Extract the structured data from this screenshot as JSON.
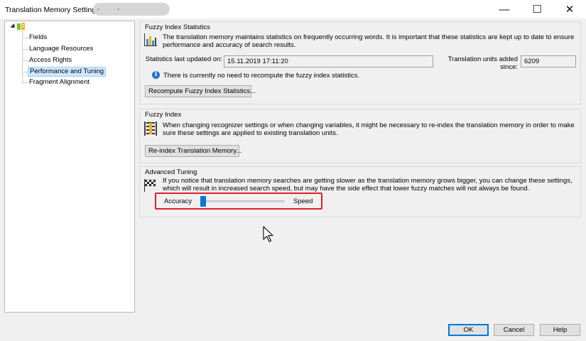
{
  "window": {
    "title": "Translation Memory Settings -",
    "minimize_glyph": "—",
    "maximize_glyph": "☐",
    "close_glyph": "✕"
  },
  "tree": {
    "root_icon": "translation-memory-icon",
    "items": [
      {
        "label": "Fields",
        "selected": false
      },
      {
        "label": "Language Resources",
        "selected": false
      },
      {
        "label": "Access Rights",
        "selected": false
      },
      {
        "label": "Performance and Tuning",
        "selected": true
      },
      {
        "label": "Fragment Alignment",
        "selected": false
      }
    ]
  },
  "fuzzy_stats": {
    "title": "Fuzzy Index Statistics",
    "icon": "bar-chart-icon",
    "description": "The translation memory maintains statistics on frequently occurring words. It is important that these statistics are kept up to date to ensure performance and accuracy of search results.",
    "last_updated_label": "Statistics last updated on:",
    "last_updated_value": "15.11.2019 17:11:20",
    "units_label": "Translation units added since:",
    "units_value": "6209",
    "info_text": "There is currently no need to recompute the fuzzy index statistics.",
    "recompute_button": "Recompute Fuzzy Index Statistics..."
  },
  "fuzzy_index": {
    "title": "Fuzzy Index",
    "icon": "index-ruler-icon",
    "description": "When changing recognizer settings or when changing variables, it might be necessary to re-index the translation memory in order to make sure these settings are applied to existing translation units.",
    "reindex_button": "Re-index Translation Memory..."
  },
  "advanced_tuning": {
    "title": "Advanced Tuning",
    "icon": "checkered-flag-icon",
    "description": "If you notice that translation memory searches are getting slower as the translation memory grows bigger, you can change these settings, which will result in increased search speed, but may have the side effect that lower fuzzy matches will not always be found.",
    "slider_left_label": "Accuracy",
    "slider_right_label": "Speed",
    "slider_value_fraction": 0.02
  },
  "footer": {
    "ok": "OK",
    "cancel": "Cancel",
    "help": "Help"
  },
  "colors": {
    "accent": "#0078d7",
    "highlight": "#e0212b",
    "selection": "#cde8ff"
  }
}
